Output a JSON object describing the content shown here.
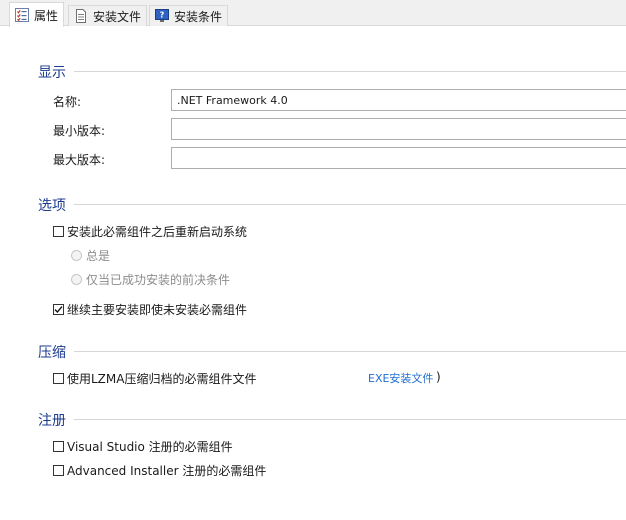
{
  "tabs": [
    {
      "label": "属性",
      "icon": "properties-list-icon",
      "active": true
    },
    {
      "label": "安装文件",
      "icon": "document-icon",
      "active": false
    },
    {
      "label": "安装条件",
      "icon": "help-monitor-icon",
      "active": false
    }
  ],
  "sections": {
    "display": {
      "title": "显示",
      "name_label": "名称:",
      "name_value": ".NET Framework 4.0",
      "min_version_label": "最小版本:",
      "min_version_value": "",
      "max_version_label": "最大版本:",
      "max_version_value": ""
    },
    "options": {
      "title": "选项",
      "restart_label": "安装此必需组件之后重新启动系统",
      "restart_checked": false,
      "always_label": "总是",
      "only_if_label": "仅当已成功安装的前决条件",
      "continue_label": "继续主要安装即使未安装必需组件",
      "continue_checked": true
    },
    "compression": {
      "title": "压缩",
      "lzma_label": "使用LZMA压缩归档的必需组件文件",
      "lzma_checked": false,
      "exe_link": "EXE安装文件",
      "paren": ")"
    },
    "registration": {
      "title": "注册",
      "vs_label": "Visual Studio 注册的必需组件",
      "vs_checked": false,
      "ai_label": "Advanced Installer 注册的必需组件",
      "ai_checked": false
    }
  }
}
